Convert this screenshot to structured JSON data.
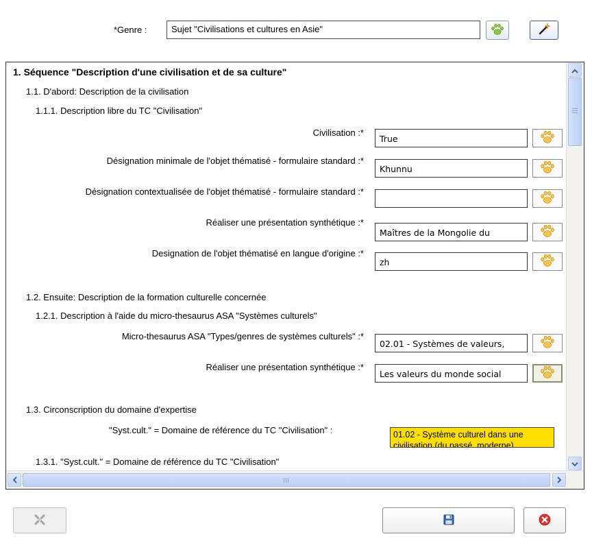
{
  "genre": {
    "label": "*Genre :",
    "value": "Sujet \"Civilisations et cultures en Asie\""
  },
  "content": {
    "section_1": "1. Séquence \"Description d'une civilisation et de sa culture\"",
    "section_1_1": "1.1. D'abord: Description de la civilisation",
    "section_1_1_1": "1.1.1. Description libre du TC \"Civilisation\"",
    "fields_a": [
      {
        "label": "Civilisation :*",
        "value": "True"
      },
      {
        "label": "Désignation minimale de l'objet thématisé - formulaire standard :*",
        "value": "Khunnu"
      },
      {
        "label": "Désignation contextualisée de l'objet thématisé - formulaire standard :*",
        "value": ""
      },
      {
        "label": "Réaliser une présentation synthétique :*",
        "value": "Maîtres de la Mongolie du"
      },
      {
        "label": "Designation de l'objet thématisé en langue d'origine :*",
        "value": "zh"
      }
    ],
    "section_1_2": "1.2. Ensuite: Description de la formation culturelle concernée",
    "section_1_2_1": "1.2.1. Description à l'aide du micro-thesaurus ASA \"Systèmes culturels\"",
    "fields_b": [
      {
        "label": "Micro-thesaurus ASA \"Types/genres de systèmes culturels\" :*",
        "value": "02.01 - Systèmes de valeurs,"
      },
      {
        "label": "Réaliser une présentation synthétique :*",
        "value": "Les valeurs du monde social"
      }
    ],
    "section_1_3": "1.3. Circonscription du domaine d'expertise",
    "domain_label": "\"Syst.cult.\" = Domaine de référence du TC \"Civilisation\" :",
    "domain_value_line1": "01.02 - Système culturel dans une",
    "domain_value_line2": "civilisation (du passé, moderne)",
    "section_1_3_1": "1.3.1. \"Syst.cult.\" = Domaine de référence du TC \"Civilisation\""
  },
  "colors": {
    "highlight": "#ffde00",
    "scroll": "#c4d6f7"
  },
  "icons": {
    "paw": "paw-icon",
    "wand": "magic-wand-icon",
    "save": "floppy-disk-icon",
    "cancel": "cancel-icon",
    "delete": "broken-link-icon"
  }
}
